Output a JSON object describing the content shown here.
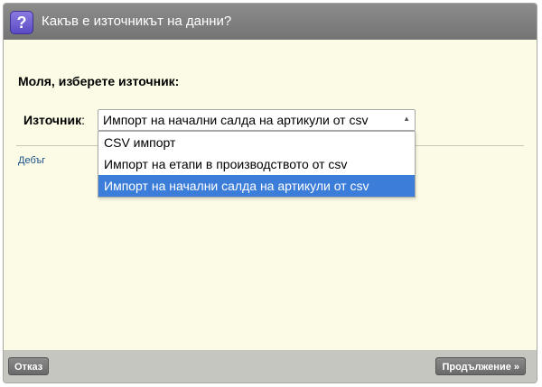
{
  "dialog": {
    "title": "Какъв е източникът на данни?",
    "help_icon_glyph": "?",
    "prompt": "Моля, изберете източник:",
    "source_label": "Източник",
    "source_colon": ":",
    "select": {
      "value": "Импорт на начални салда на артикули от csv",
      "options": [
        "CSV импорт",
        "Импорт на етапи в производството от csv",
        "Импорт на начални салда на артикули от csv"
      ],
      "selected_index": 2
    },
    "debug_link": "Дебъг",
    "buttons": {
      "cancel": "Отказ",
      "continue": "Продължение »"
    }
  },
  "colors": {
    "background": "#fcfce6",
    "titlebar": "#808080",
    "accent": "#3b7dd8",
    "footer": "#c6c6c0"
  }
}
